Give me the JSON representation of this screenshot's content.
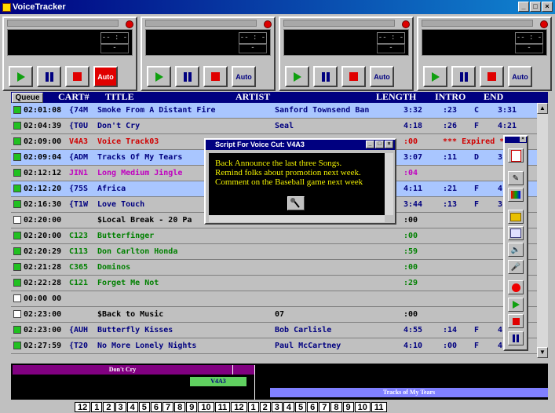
{
  "window": {
    "title": "VoiceTracker",
    "buttons": [
      "_",
      "□",
      "×"
    ]
  },
  "decks": [
    {
      "counter": "-- : --",
      "auto": "Auto",
      "auto_active": true
    },
    {
      "counter": "-- : --",
      "auto": "Auto",
      "auto_active": false
    },
    {
      "counter": "-- : --",
      "auto": "Auto",
      "auto_active": false
    },
    {
      "counter": "-- : --",
      "auto": "Auto",
      "auto_active": false
    }
  ],
  "header": {
    "queue": "Queue",
    "cart": "CART#",
    "title": "TITLE",
    "artist": "ARTIST",
    "length": "LENGTH",
    "intro": "INTRO",
    "end": "END"
  },
  "rows": [
    {
      "time": "02:01:08",
      "cart": "{74M",
      "title": "Smoke From A Distant Fire",
      "artist": "Sanford Townsend Ban",
      "length": "3:32",
      "intro": ":23",
      "type": "C",
      "end": "3:31",
      "color": "#000080",
      "box": "green",
      "highlight": true
    },
    {
      "time": "02:04:39",
      "cart": "{T0U",
      "title": "Don't Cry",
      "artist": "Seal",
      "length": "4:18",
      "intro": ":26",
      "type": "F",
      "end": "4:21",
      "color": "#000080",
      "box": "green",
      "highlight": false
    },
    {
      "time": "02:09:00",
      "cart": "V4A3",
      "title": "Voice Track03",
      "artist": "",
      "length": ":00",
      "intro": "*** Expired **",
      "type": "",
      "end": "",
      "color": "#d00000",
      "box": "green",
      "highlight": false
    },
    {
      "time": "02:09:04",
      "cart": "{ADM",
      "title": "Tracks Of My Tears",
      "artist": "",
      "length": "3:07",
      "intro": ":11",
      "type": "D",
      "end": "3",
      "color": "#000080",
      "box": "green",
      "highlight": true
    },
    {
      "time": "02:12:12",
      "cart": "JIN1",
      "title": "Long Medium Jingle",
      "artist": "",
      "length": ":04",
      "intro": "",
      "type": "",
      "end": "",
      "color": "#c000c0",
      "box": "green",
      "highlight": false
    },
    {
      "time": "02:12:20",
      "cart": "{75S",
      "title": "Africa",
      "artist": "",
      "length": "4:11",
      "intro": ":21",
      "type": "F",
      "end": "4",
      "color": "#000080",
      "box": "green",
      "highlight": true
    },
    {
      "time": "02:16:30",
      "cart": "{T1W",
      "title": "Love Touch",
      "artist": "",
      "length": "3:44",
      "intro": ":13",
      "type": "F",
      "end": "3",
      "color": "#000080",
      "box": "green",
      "highlight": false
    },
    {
      "time": "02:20:00",
      "cart": "",
      "title": "$Local Break - 20 Pa",
      "artist": "",
      "length": ":00",
      "intro": "",
      "type": "",
      "end": "",
      "color": "#000000",
      "box": "white",
      "highlight": false
    },
    {
      "time": "02:20:00",
      "cart": "C123",
      "title": "Butterfinger",
      "artist": "",
      "length": ":00",
      "intro": "",
      "type": "",
      "end": "",
      "color": "#008000",
      "box": "green",
      "highlight": false
    },
    {
      "time": "02:20:29",
      "cart": "C113",
      "title": "Don Carlton Honda",
      "artist": "",
      "length": ":59",
      "intro": "",
      "type": "",
      "end": "",
      "color": "#008000",
      "box": "green",
      "highlight": false
    },
    {
      "time": "02:21:28",
      "cart": "C365",
      "title": "Dominos",
      "artist": "",
      "length": ":00",
      "intro": "",
      "type": "",
      "end": "",
      "color": "#008000",
      "box": "green",
      "highlight": false
    },
    {
      "time": "02:22:28",
      "cart": "C121",
      "title": "Forget Me Not",
      "artist": "",
      "length": ":29",
      "intro": "",
      "type": "",
      "end": "",
      "color": "#008000",
      "box": "green",
      "highlight": false
    },
    {
      "time": "00:00 00",
      "cart": "",
      "title": "",
      "artist": "",
      "length": "",
      "intro": "",
      "type": "",
      "end": "",
      "color": "#000000",
      "box": "white",
      "highlight": false
    },
    {
      "time": "02:23:00",
      "cart": "",
      "title": "$Back to Music",
      "artist": "07",
      "length": ":00",
      "intro": "",
      "type": "",
      "end": "",
      "color": "#000000",
      "box": "white",
      "highlight": false
    },
    {
      "time": "02:23:00",
      "cart": "{AUH",
      "title": "Butterfly Kisses",
      "artist": "Bob Carlisle",
      "length": "4:55",
      "intro": ":14",
      "type": "F",
      "end": "4",
      "color": "#000080",
      "box": "green",
      "highlight": false
    },
    {
      "time": "02:27:59",
      "cart": "{T20",
      "title": "No More Lonely Nights",
      "artist": "Paul McCartney",
      "length": "4:10",
      "intro": ":00",
      "type": "F",
      "end": "4",
      "color": "#000080",
      "box": "green",
      "highlight": false
    }
  ],
  "dialog": {
    "title": "Script For Voice Cut:  V4A3",
    "lines": [
      "Back Announce the last three Songs.",
      "Remind folks about promotion next week.",
      "Comment on the Baseball game next week"
    ]
  },
  "toolbar": {
    "icons": [
      "log-icon",
      "pencil-icon",
      "palette-icon",
      "folder-icon",
      "document-icon",
      "speaker-icon",
      "microphone-icon",
      "record-icon",
      "play-icon",
      "stop-icon",
      "pause-icon"
    ]
  },
  "timeline": {
    "bars": [
      "Don't Cry",
      "V4A3",
      "Tracks of My Tears"
    ]
  },
  "hours": [
    "12",
    "1",
    "2",
    "3",
    "4",
    "5",
    "6",
    "7",
    "8",
    "9",
    "10",
    "11",
    "12",
    "1",
    "2",
    "3",
    "4",
    "5",
    "6",
    "7",
    "8",
    "9",
    "10",
    "11"
  ]
}
